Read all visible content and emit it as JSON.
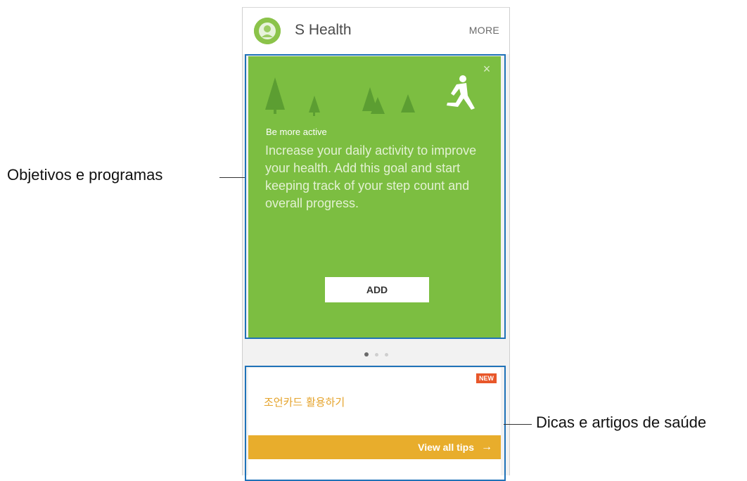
{
  "app": {
    "title": "S Health",
    "more_label": "MORE",
    "logo_icon": "s-health-logo-icon"
  },
  "goal_card": {
    "eyebrow": "Be more active",
    "body": "Increase your daily activity to improve your health. Add this goal and start keeping track of your step count and overall progress.",
    "add_label": "ADD",
    "close_icon": "close-icon",
    "background_color": "#7cbe41"
  },
  "pager": {
    "count": 3,
    "active_index": 0
  },
  "tips_card": {
    "badge": "NEW",
    "title": "조언카드 활용하기",
    "view_all_label": "View all tips",
    "arrow_icon": "arrow-right-icon",
    "accent_color": "#e8ad2c"
  },
  "callouts": {
    "goals": "Objetivos e programas",
    "tips": "Dicas e artigos de saúde"
  },
  "colors": {
    "highlight_frame": "#1f72b8"
  }
}
